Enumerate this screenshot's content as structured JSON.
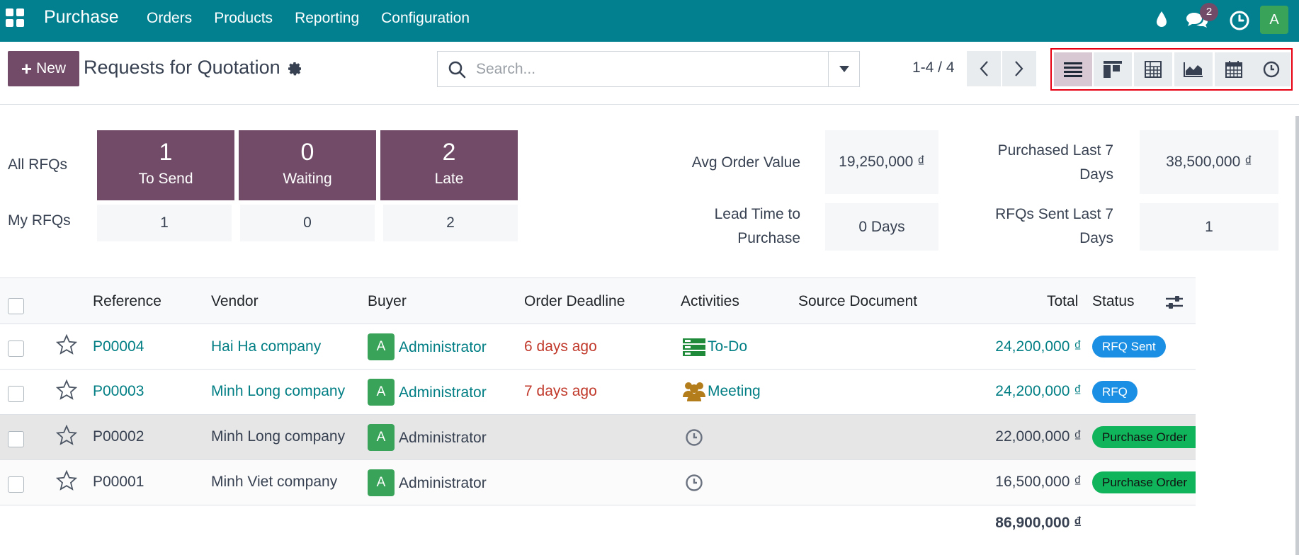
{
  "navbar": {
    "app_name": "Purchase",
    "menu": [
      "Orders",
      "Products",
      "Reporting",
      "Configuration"
    ],
    "chat_badge": "2",
    "user_initial": "A",
    "color": "#028090"
  },
  "control": {
    "new_label": "New",
    "title": "Requests for Quotation",
    "search_placeholder": "Search...",
    "pager": "1-4 / 4",
    "views": [
      "list-view-icon",
      "kanban-view-icon",
      "pivot-view-icon",
      "graph-view-icon",
      "calendar-view-icon",
      "activity-view-icon"
    ],
    "active_view": "list-view-icon"
  },
  "dashboard": {
    "all_rfqs_label": "All RFQs",
    "my_rfqs_label": "My RFQs",
    "tiles": [
      {
        "num": "1",
        "label": "To Send"
      },
      {
        "num": "0",
        "label": "Waiting"
      },
      {
        "num": "2",
        "label": "Late"
      }
    ],
    "my_values": [
      "1",
      "0",
      "2"
    ],
    "stats": {
      "avg_order_label": "Avg Order Value",
      "avg_order_value": "19,250,000 ₫",
      "purchased_label_1": "Purchased Last 7",
      "purchased_label_2": "Days",
      "purchased_value": "38,500,000 ₫",
      "lead_label_1": "Lead Time to",
      "lead_label_2": "Purchase",
      "lead_value": "0 Days",
      "sent_label_1": "RFQs Sent Last 7",
      "sent_label_2": "Days",
      "sent_value": "1"
    },
    "tile_color": "#714B67"
  },
  "table": {
    "headers": {
      "reference": "Reference",
      "vendor": "Vendor",
      "buyer": "Buyer",
      "deadline": "Order Deadline",
      "activities": "Activities",
      "source": "Source Document",
      "total": "Total",
      "status": "Status"
    },
    "rows": [
      {
        "ref": "P00004",
        "vendor": "Hai Ha company",
        "buyer_initial": "A",
        "buyer": "Administrator",
        "deadline": "6 days ago",
        "activity": "To-Do",
        "total": "24,200,000 ₫",
        "status": "RFQ Sent"
      },
      {
        "ref": "P00003",
        "vendor": "Minh Long company",
        "buyer_initial": "A",
        "buyer": "Administrator",
        "deadline": "7 days ago",
        "activity": "Meeting",
        "total": "24,200,000 ₫",
        "status": "RFQ"
      },
      {
        "ref": "P00002",
        "vendor": "Minh Long company",
        "buyer_initial": "A",
        "buyer": "Administrator",
        "deadline": "",
        "activity": "",
        "total": "22,000,000 ₫",
        "status": "Purchase Order"
      },
      {
        "ref": "P00001",
        "vendor": "Minh Viet company",
        "buyer_initial": "A",
        "buyer": "Administrator",
        "deadline": "",
        "activity": "",
        "total": "16,500,000 ₫",
        "status": "Purchase Order"
      }
    ],
    "grand_total": "86,900,000 ₫",
    "status_colors": {
      "rfq": "#1a8fe3",
      "purchase_order": "#10b55b"
    }
  }
}
